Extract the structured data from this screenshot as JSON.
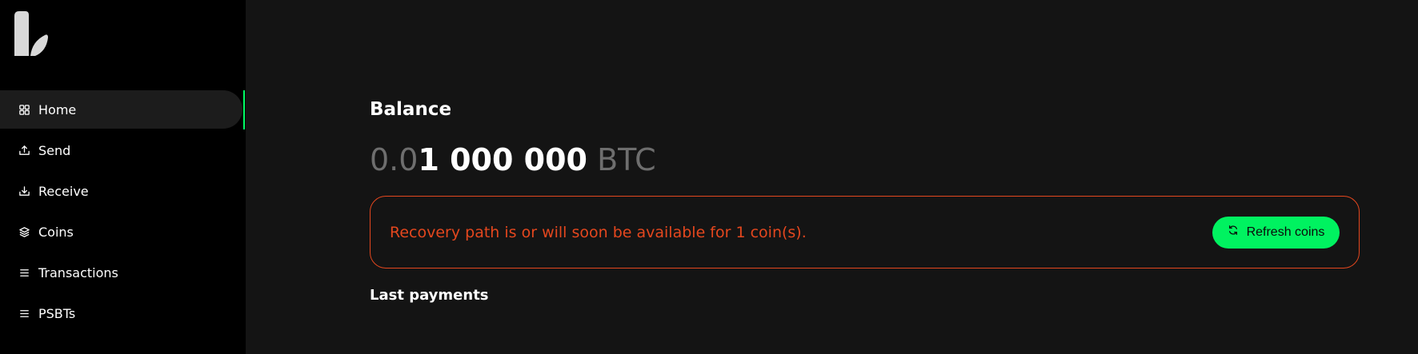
{
  "sidebar": {
    "logo_icon": "wallet-logo",
    "items": [
      {
        "label": "Home",
        "icon": "grid-icon",
        "active": true
      },
      {
        "label": "Send",
        "icon": "upload-icon",
        "active": false
      },
      {
        "label": "Receive",
        "icon": "download-icon",
        "active": false
      },
      {
        "label": "Coins",
        "icon": "layers-icon",
        "active": false
      },
      {
        "label": "Transactions",
        "icon": "list-icon",
        "active": false
      },
      {
        "label": "PSBTs",
        "icon": "list-icon",
        "active": false
      }
    ]
  },
  "main": {
    "balance_title": "Balance",
    "balance": {
      "dim_prefix": "0.0",
      "strong_part": "1 000 000",
      "unit": "BTC"
    },
    "alert": {
      "text": "Recovery path is or will soon be available for 1 coin(s).",
      "button_label": "Refresh coins",
      "button_icon": "refresh-icon"
    },
    "last_payments_title": "Last payments"
  },
  "colors": {
    "accent": "#00f260",
    "warning": "#e4471e",
    "sidebar_bg": "#000000",
    "main_bg": "#141414"
  }
}
